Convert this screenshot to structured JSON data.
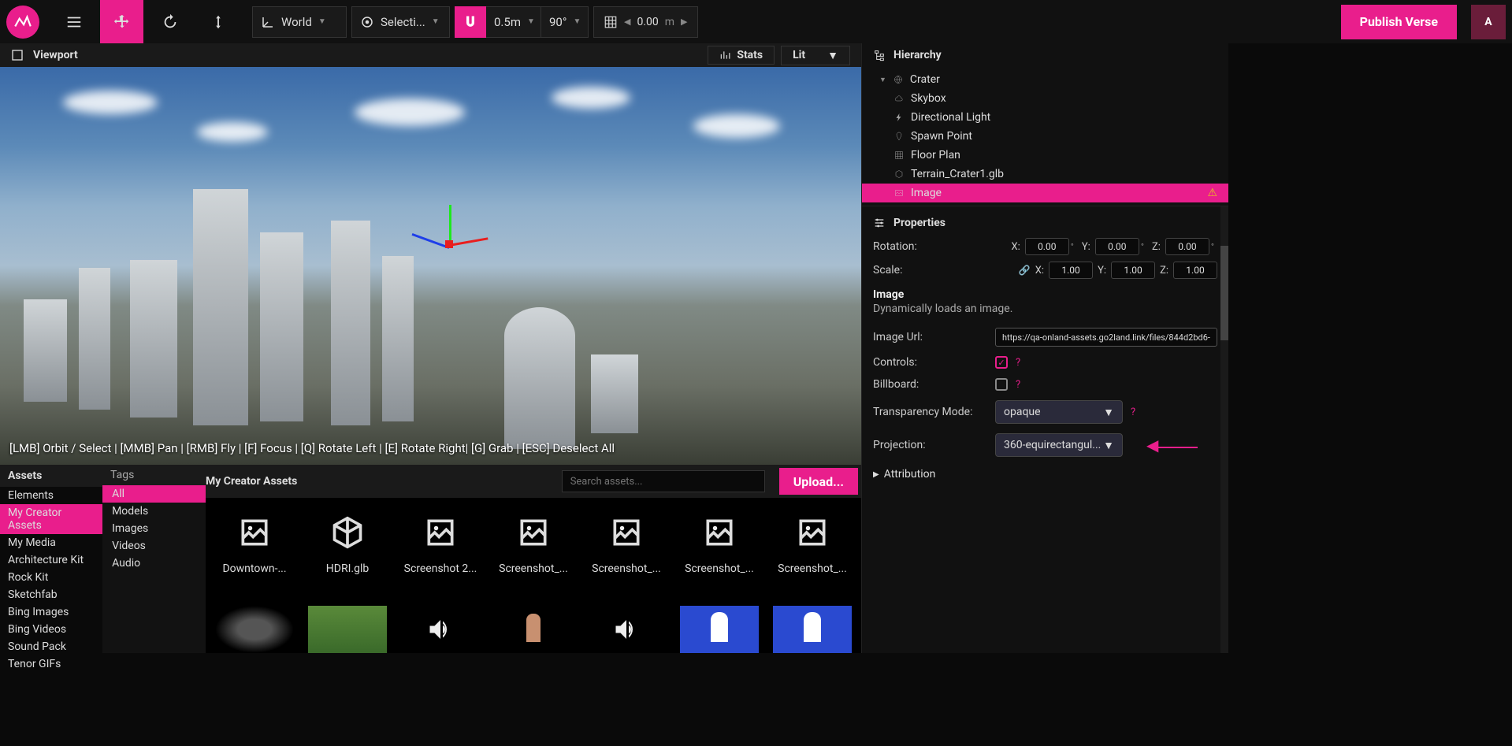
{
  "topbar": {
    "coord_space": "World",
    "pivot": "Selecti...",
    "snap_dist": "0.5m",
    "snap_angle": "90°",
    "grid_value": "0.00",
    "grid_unit": "m",
    "publish": "Publish Verse",
    "avatar": "A"
  },
  "viewport": {
    "tab": "Viewport",
    "stats": "Stats",
    "render_mode": "Lit",
    "hints": "[LMB] Orbit / Select | [MMB] Pan | [RMB] Fly | [F] Focus | [Q] Rotate Left | [E] Rotate Right| [G] Grab | [ESC] Deselect All"
  },
  "hierarchy": {
    "title": "Hierarchy",
    "items": [
      {
        "label": "Crater",
        "indent": 0,
        "icon": "globe"
      },
      {
        "label": "Skybox",
        "indent": 1,
        "icon": "cloud"
      },
      {
        "label": "Directional Light",
        "indent": 1,
        "icon": "bolt"
      },
      {
        "label": "Spawn Point",
        "indent": 1,
        "icon": "pin"
      },
      {
        "label": "Floor Plan",
        "indent": 1,
        "icon": "grid"
      },
      {
        "label": "Terrain_Crater1.glb",
        "indent": 1,
        "icon": "cube"
      },
      {
        "label": "Image",
        "indent": 1,
        "icon": "image",
        "selected": true,
        "warn": true
      }
    ]
  },
  "properties": {
    "title": "Properties",
    "rotation_label": "Rotation:",
    "scale_label": "Scale:",
    "rotation": {
      "x": "0.00",
      "y": "0.00",
      "z": "0.00"
    },
    "scale": {
      "x": "1.00",
      "y": "1.00",
      "z": "1.00"
    },
    "section": "Image",
    "section_desc": "Dynamically loads an image.",
    "image_url_label": "Image Url:",
    "image_url": "https://qa-onland-assets.go2land.link/files/844d2bd6-",
    "controls_label": "Controls:",
    "controls_checked": true,
    "billboard_label": "Billboard:",
    "billboard_checked": false,
    "transparency_label": "Transparency Mode:",
    "transparency_value": "opaque",
    "projection_label": "Projection:",
    "projection_value": "360-equirectangul...",
    "attribution": "Attribution"
  },
  "assets": {
    "panel_title": "Assets",
    "libs": [
      "Elements",
      "My Creator Assets",
      "My Media",
      "Architecture Kit",
      "Rock Kit",
      "Sketchfab",
      "Bing Images",
      "Bing Videos",
      "Sound Pack",
      "Tenor GIFs"
    ],
    "lib_active_index": 1,
    "tags_title": "Tags",
    "tags": [
      "All",
      "Models",
      "Images",
      "Videos",
      "Audio"
    ],
    "tag_active_index": 0,
    "main_title": "My Creator Assets",
    "search_placeholder": "Search assets...",
    "upload": "Upload...",
    "items": [
      {
        "label": "Downtown-...",
        "type": "image"
      },
      {
        "label": "HDRI.glb",
        "type": "model"
      },
      {
        "label": "Screenshot 2...",
        "type": "image"
      },
      {
        "label": "Screenshot_...",
        "type": "image"
      },
      {
        "label": "Screenshot_...",
        "type": "image"
      },
      {
        "label": "Screenshot_...",
        "type": "image"
      },
      {
        "label": "Screenshot_...",
        "type": "image"
      }
    ]
  }
}
